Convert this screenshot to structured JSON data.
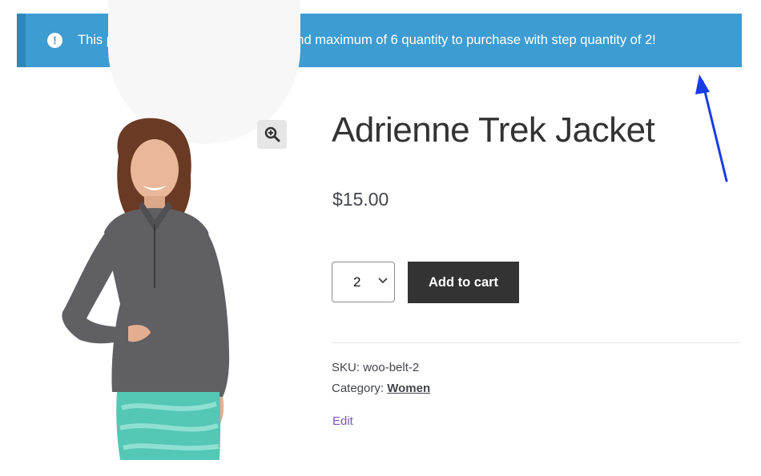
{
  "notice": {
    "icon": "exclamation-circle-icon",
    "text": "This product required minimum of 2 and maximum of 6 quantity to purchase with step quantity of 2!",
    "color": "#3d9cd2"
  },
  "product": {
    "title": "Adrienne Trek Jacket",
    "price": "$15.00",
    "quantity": "2",
    "add_to_cart_label": "Add to cart",
    "sku_label": "SKU:",
    "sku_value": "woo-belt-2",
    "category_label": "Category:",
    "category_value": "Women",
    "edit_label": "Edit"
  },
  "gallery": {
    "zoom_icon": "magnifier-zoom-icon"
  },
  "annotation": {
    "arrow_color": "#1a3be8"
  }
}
